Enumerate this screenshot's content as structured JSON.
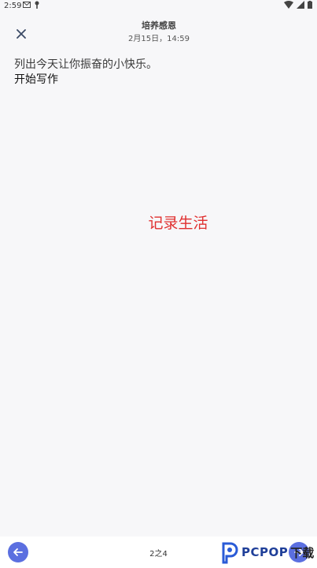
{
  "status_bar": {
    "time": "2:59"
  },
  "header": {
    "title": "培养感恩",
    "date": "2月15日，14:59"
  },
  "content": {
    "prompt": "列出今天让你振奋的小快乐。",
    "editor_placeholder": "开始写作",
    "center_caption": "记录生活"
  },
  "footer": {
    "page_indicator": "2之4"
  },
  "watermark": {
    "brand": "PCPOP",
    "suffix": "下载"
  },
  "colors": {
    "accent": "#5b6fe0",
    "caption_red": "#e03030",
    "background": "#f7f7f9"
  }
}
